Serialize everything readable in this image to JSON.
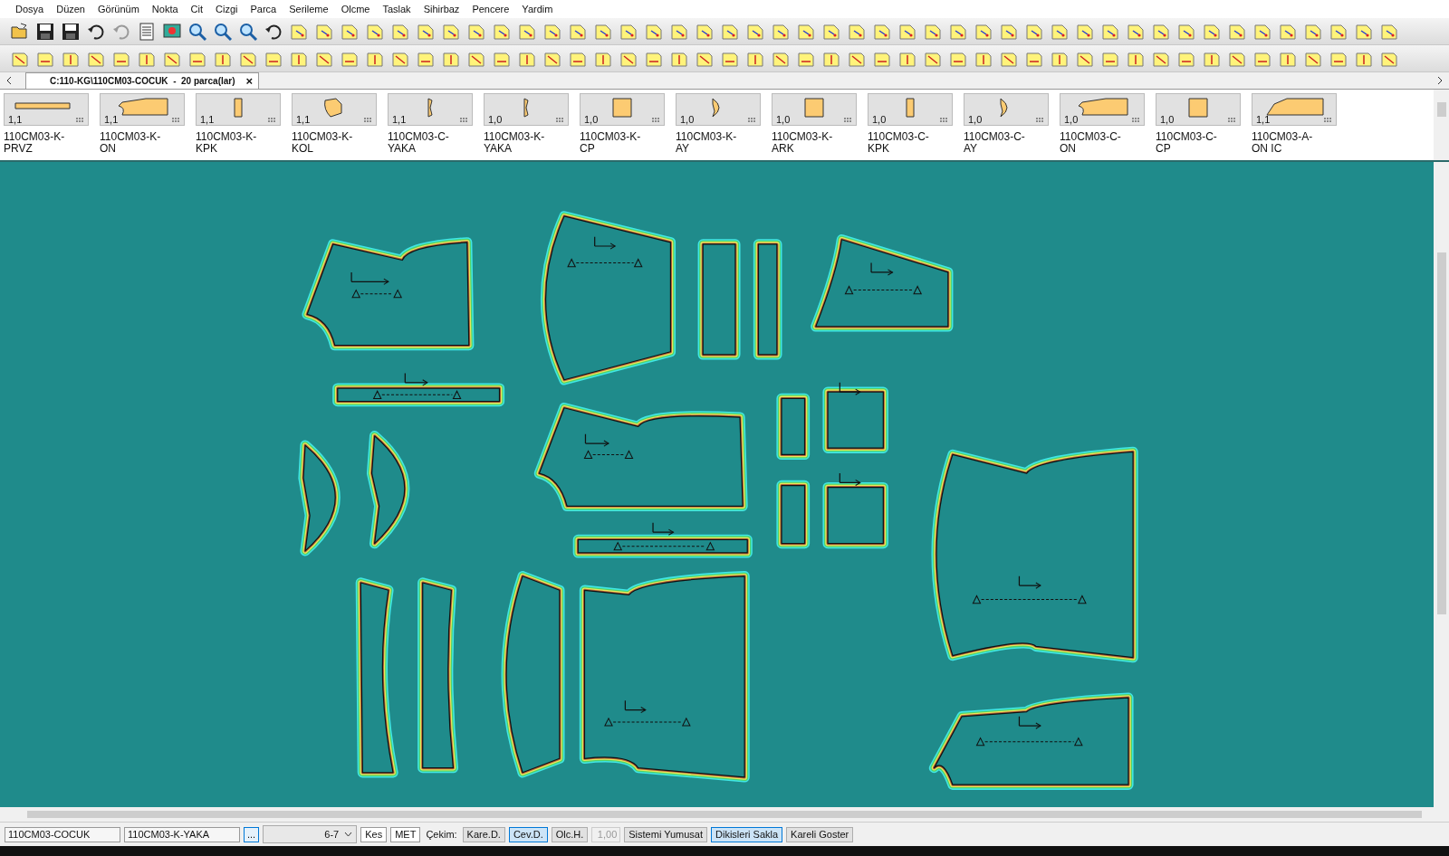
{
  "menu": [
    "Dosya",
    "Düzen",
    "Görünüm",
    "Nokta",
    "Cit",
    "Cizgi",
    "Parca",
    "Serileme",
    "Olcme",
    "Taslak",
    "Sihirbaz",
    "Pencere",
    "Yardim"
  ],
  "tab": {
    "title": "C:110-KG\\110CM03-COCUK  -  20 parca(lar)",
    "close": "×"
  },
  "pieces": [
    {
      "quantity": "1,1",
      "name": [
        "110CM03-K-",
        "PRVZ"
      ],
      "kind": "strip"
    },
    {
      "quantity": "1,1",
      "name": [
        "110CM03-K-",
        "ON"
      ],
      "kind": "body"
    },
    {
      "quantity": "1,1",
      "name": [
        "110CM03-K-",
        "KPK"
      ],
      "kind": "tall"
    },
    {
      "quantity": "1,1",
      "name": [
        "110CM03-K-",
        "KOL"
      ],
      "kind": "sleeve"
    },
    {
      "quantity": "1,1",
      "name": [
        "110CM03-C-",
        "YAKA"
      ],
      "kind": "collar"
    },
    {
      "quantity": "1,0",
      "name": [
        "110CM03-K-",
        "YAKA"
      ],
      "kind": "collar"
    },
    {
      "quantity": "1,0",
      "name": [
        "110CM03-K-",
        "CP"
      ],
      "kind": "square"
    },
    {
      "quantity": "1,0",
      "name": [
        "110CM03-K-",
        "AY"
      ],
      "kind": "moon"
    },
    {
      "quantity": "1,0",
      "name": [
        "110CM03-K-",
        "ARK"
      ],
      "kind": "square"
    },
    {
      "quantity": "1,0",
      "name": [
        "110CM03-C-",
        "KPK"
      ],
      "kind": "tall"
    },
    {
      "quantity": "1,0",
      "name": [
        "110CM03-C-",
        "AY"
      ],
      "kind": "moon"
    },
    {
      "quantity": "1,0",
      "name": [
        "110CM03-C-",
        "ON"
      ],
      "kind": "body"
    },
    {
      "quantity": "1,0",
      "name": [
        "110CM03-C-",
        "CP"
      ],
      "kind": "square"
    },
    {
      "quantity": "1,1",
      "name": [
        "110CM03-A-",
        "ON IC"
      ],
      "kind": "wide"
    }
  ],
  "status_bar": {
    "model_field": "110CM03-COCUK",
    "piece_field": "110CM03-K-YAKA",
    "browse_button": "...",
    "size_select": "6-7",
    "cut_button": "Kes",
    "unit_button": "MET",
    "draw_label": "Çekim:",
    "toggles": [
      {
        "label": "Kare.D.",
        "selected": false
      },
      {
        "label": "Cev.D.",
        "selected": true
      },
      {
        "label": "Olc.H.",
        "selected": false
      }
    ],
    "factor_field": {
      "value": "1,00",
      "disabled": true
    },
    "actions": [
      {
        "label": "Sistemi Yumusat",
        "selected": false
      },
      {
        "label": "Dikisleri Sakla",
        "selected": true
      },
      {
        "label": "Kareli Goster",
        "selected": false
      }
    ]
  }
}
